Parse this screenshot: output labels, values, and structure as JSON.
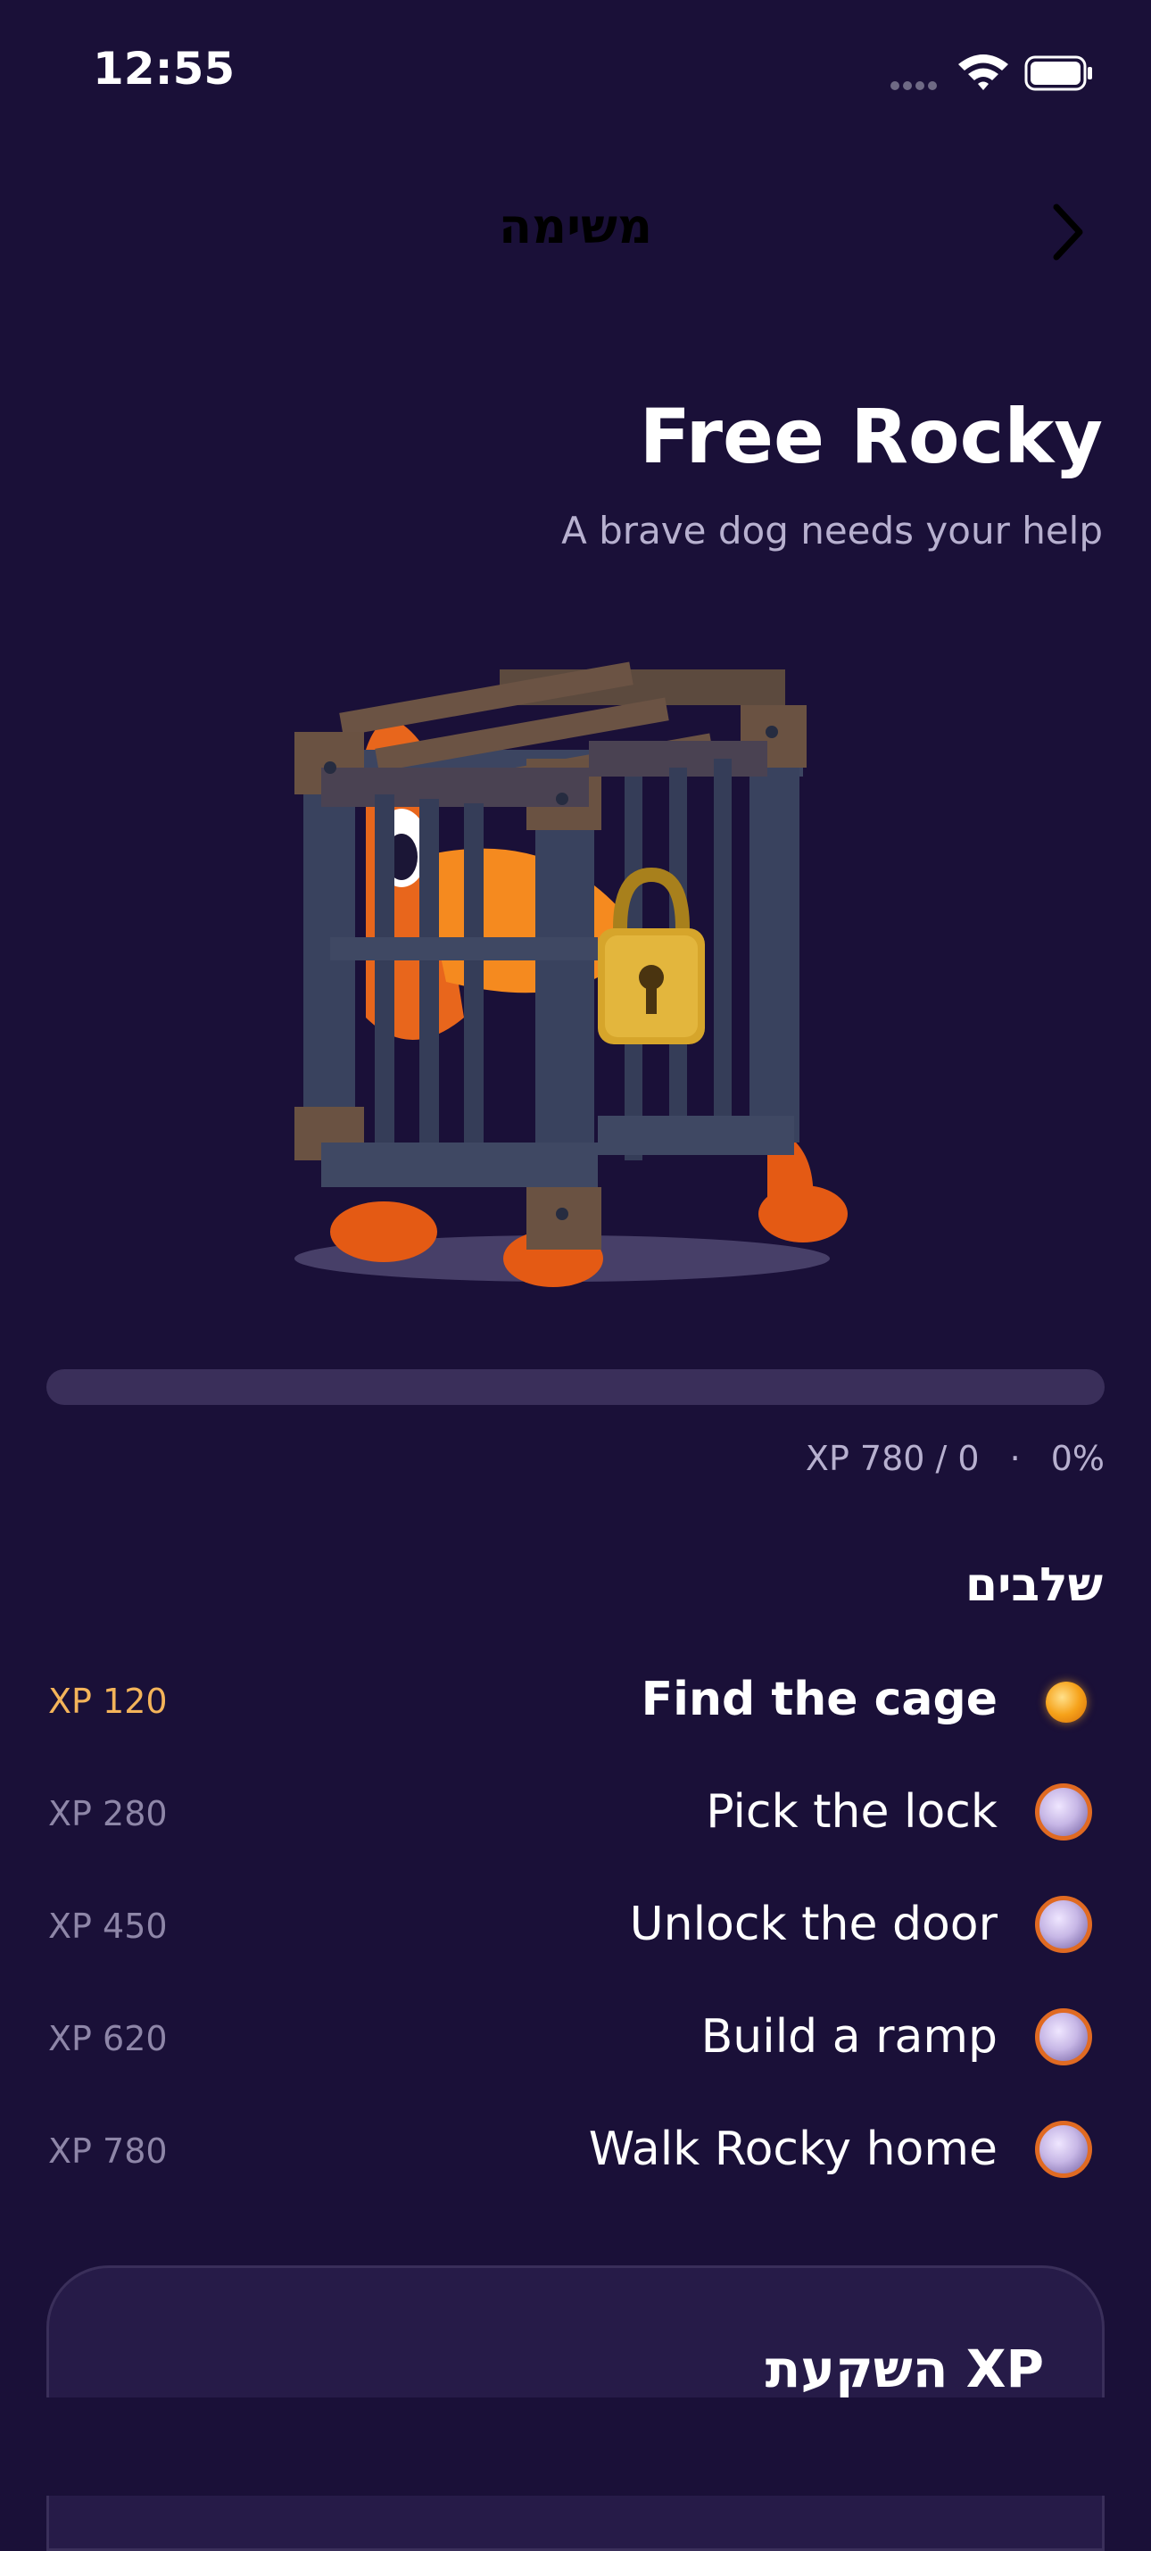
{
  "status_bar": {
    "time": "12:55"
  },
  "nav": {
    "title": "משימה"
  },
  "mission": {
    "title": "Free Rocky",
    "subtitle": "A brave dog needs your help"
  },
  "progress": {
    "fraction": 0.0,
    "xp_text": "XP 780 / 0",
    "separator": "·",
    "percent_text": "0%"
  },
  "steps": {
    "heading": "שלבים",
    "items": [
      {
        "label": "Find the cage",
        "xp": "XP 120",
        "state": "current"
      },
      {
        "label": "Pick the lock",
        "xp": "XP 280",
        "state": "pending"
      },
      {
        "label": "Unlock the door",
        "xp": "XP 450",
        "state": "pending"
      },
      {
        "label": "Build a ramp",
        "xp": "XP 620",
        "state": "pending"
      },
      {
        "label": "Walk Rocky home",
        "xp": "XP 780",
        "state": "pending"
      }
    ]
  },
  "invest": {
    "title": "השקעת XP"
  },
  "colors": {
    "background": "#1a1038",
    "accent": "#f5a623",
    "step_ring": "#e06a22",
    "muted_text": "#b7b0cf"
  },
  "icons": [
    "wifi-icon",
    "battery-icon",
    "chevron-right-icon",
    "cage-illustration"
  ]
}
